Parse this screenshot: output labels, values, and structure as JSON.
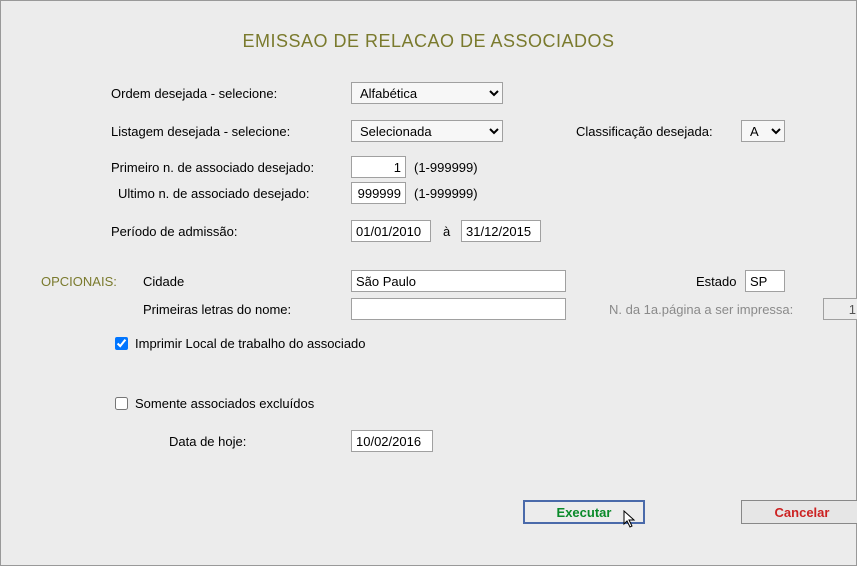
{
  "title": "EMISSAO DE RELACAO DE ASSOCIADOS",
  "labels": {
    "ordem": "Ordem desejada - selecione:",
    "listagem": "Listagem desejada - selecione:",
    "classificacao": "Classificação desejada:",
    "primeiro_n": "Primeiro n. de associado desejado:",
    "ultimo_n": "Ultimo  n. de associado desejado:",
    "range_hint": "(1-999999)",
    "periodo": "Período de admissão:",
    "a": "à",
    "opcionais": "OPCIONAIS:",
    "cidade": "Cidade",
    "estado": "Estado",
    "primeiras_letras": "Primeiras letras do nome:",
    "n_pagina": "N. da 1a.página a ser impressa:",
    "imprimir_local": "Imprimir Local de trabalho do associado",
    "somente_excluidos": "Somente associados excluídos",
    "data_hoje": "Data de hoje:"
  },
  "fields": {
    "ordem": "Alfabética",
    "listagem": "Selecionada",
    "classificacao": "A",
    "primeiro_n": "1",
    "ultimo_n": "999999",
    "periodo_ini": "01/01/2010",
    "periodo_fim": "31/12/2015",
    "cidade": "São Paulo",
    "estado": "SP",
    "primeiras_letras": "",
    "n_pagina": "1",
    "imprimir_local_checked": true,
    "somente_excluidos_checked": false,
    "data_hoje": "10/02/2016"
  },
  "buttons": {
    "executar": "Executar",
    "cancelar": "Cancelar"
  }
}
